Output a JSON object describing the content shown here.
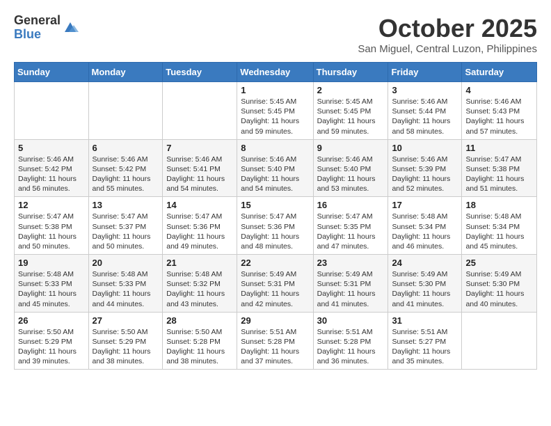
{
  "header": {
    "logo_general": "General",
    "logo_blue": "Blue",
    "month_title": "October 2025",
    "location": "San Miguel, Central Luzon, Philippines"
  },
  "weekdays": [
    "Sunday",
    "Monday",
    "Tuesday",
    "Wednesday",
    "Thursday",
    "Friday",
    "Saturday"
  ],
  "weeks": [
    [
      {
        "day": "",
        "info": ""
      },
      {
        "day": "",
        "info": ""
      },
      {
        "day": "",
        "info": ""
      },
      {
        "day": "1",
        "info": "Sunrise: 5:45 AM\nSunset: 5:45 PM\nDaylight: 11 hours\nand 59 minutes."
      },
      {
        "day": "2",
        "info": "Sunrise: 5:45 AM\nSunset: 5:45 PM\nDaylight: 11 hours\nand 59 minutes."
      },
      {
        "day": "3",
        "info": "Sunrise: 5:46 AM\nSunset: 5:44 PM\nDaylight: 11 hours\nand 58 minutes."
      },
      {
        "day": "4",
        "info": "Sunrise: 5:46 AM\nSunset: 5:43 PM\nDaylight: 11 hours\nand 57 minutes."
      }
    ],
    [
      {
        "day": "5",
        "info": "Sunrise: 5:46 AM\nSunset: 5:42 PM\nDaylight: 11 hours\nand 56 minutes."
      },
      {
        "day": "6",
        "info": "Sunrise: 5:46 AM\nSunset: 5:42 PM\nDaylight: 11 hours\nand 55 minutes."
      },
      {
        "day": "7",
        "info": "Sunrise: 5:46 AM\nSunset: 5:41 PM\nDaylight: 11 hours\nand 54 minutes."
      },
      {
        "day": "8",
        "info": "Sunrise: 5:46 AM\nSunset: 5:40 PM\nDaylight: 11 hours\nand 54 minutes."
      },
      {
        "day": "9",
        "info": "Sunrise: 5:46 AM\nSunset: 5:40 PM\nDaylight: 11 hours\nand 53 minutes."
      },
      {
        "day": "10",
        "info": "Sunrise: 5:46 AM\nSunset: 5:39 PM\nDaylight: 11 hours\nand 52 minutes."
      },
      {
        "day": "11",
        "info": "Sunrise: 5:47 AM\nSunset: 5:38 PM\nDaylight: 11 hours\nand 51 minutes."
      }
    ],
    [
      {
        "day": "12",
        "info": "Sunrise: 5:47 AM\nSunset: 5:38 PM\nDaylight: 11 hours\nand 50 minutes."
      },
      {
        "day": "13",
        "info": "Sunrise: 5:47 AM\nSunset: 5:37 PM\nDaylight: 11 hours\nand 50 minutes."
      },
      {
        "day": "14",
        "info": "Sunrise: 5:47 AM\nSunset: 5:36 PM\nDaylight: 11 hours\nand 49 minutes."
      },
      {
        "day": "15",
        "info": "Sunrise: 5:47 AM\nSunset: 5:36 PM\nDaylight: 11 hours\nand 48 minutes."
      },
      {
        "day": "16",
        "info": "Sunrise: 5:47 AM\nSunset: 5:35 PM\nDaylight: 11 hours\nand 47 minutes."
      },
      {
        "day": "17",
        "info": "Sunrise: 5:48 AM\nSunset: 5:34 PM\nDaylight: 11 hours\nand 46 minutes."
      },
      {
        "day": "18",
        "info": "Sunrise: 5:48 AM\nSunset: 5:34 PM\nDaylight: 11 hours\nand 45 minutes."
      }
    ],
    [
      {
        "day": "19",
        "info": "Sunrise: 5:48 AM\nSunset: 5:33 PM\nDaylight: 11 hours\nand 45 minutes."
      },
      {
        "day": "20",
        "info": "Sunrise: 5:48 AM\nSunset: 5:33 PM\nDaylight: 11 hours\nand 44 minutes."
      },
      {
        "day": "21",
        "info": "Sunrise: 5:48 AM\nSunset: 5:32 PM\nDaylight: 11 hours\nand 43 minutes."
      },
      {
        "day": "22",
        "info": "Sunrise: 5:49 AM\nSunset: 5:31 PM\nDaylight: 11 hours\nand 42 minutes."
      },
      {
        "day": "23",
        "info": "Sunrise: 5:49 AM\nSunset: 5:31 PM\nDaylight: 11 hours\nand 41 minutes."
      },
      {
        "day": "24",
        "info": "Sunrise: 5:49 AM\nSunset: 5:30 PM\nDaylight: 11 hours\nand 41 minutes."
      },
      {
        "day": "25",
        "info": "Sunrise: 5:49 AM\nSunset: 5:30 PM\nDaylight: 11 hours\nand 40 minutes."
      }
    ],
    [
      {
        "day": "26",
        "info": "Sunrise: 5:50 AM\nSunset: 5:29 PM\nDaylight: 11 hours\nand 39 minutes."
      },
      {
        "day": "27",
        "info": "Sunrise: 5:50 AM\nSunset: 5:29 PM\nDaylight: 11 hours\nand 38 minutes."
      },
      {
        "day": "28",
        "info": "Sunrise: 5:50 AM\nSunset: 5:28 PM\nDaylight: 11 hours\nand 38 minutes."
      },
      {
        "day": "29",
        "info": "Sunrise: 5:51 AM\nSunset: 5:28 PM\nDaylight: 11 hours\nand 37 minutes."
      },
      {
        "day": "30",
        "info": "Sunrise: 5:51 AM\nSunset: 5:28 PM\nDaylight: 11 hours\nand 36 minutes."
      },
      {
        "day": "31",
        "info": "Sunrise: 5:51 AM\nSunset: 5:27 PM\nDaylight: 11 hours\nand 35 minutes."
      },
      {
        "day": "",
        "info": ""
      }
    ]
  ]
}
